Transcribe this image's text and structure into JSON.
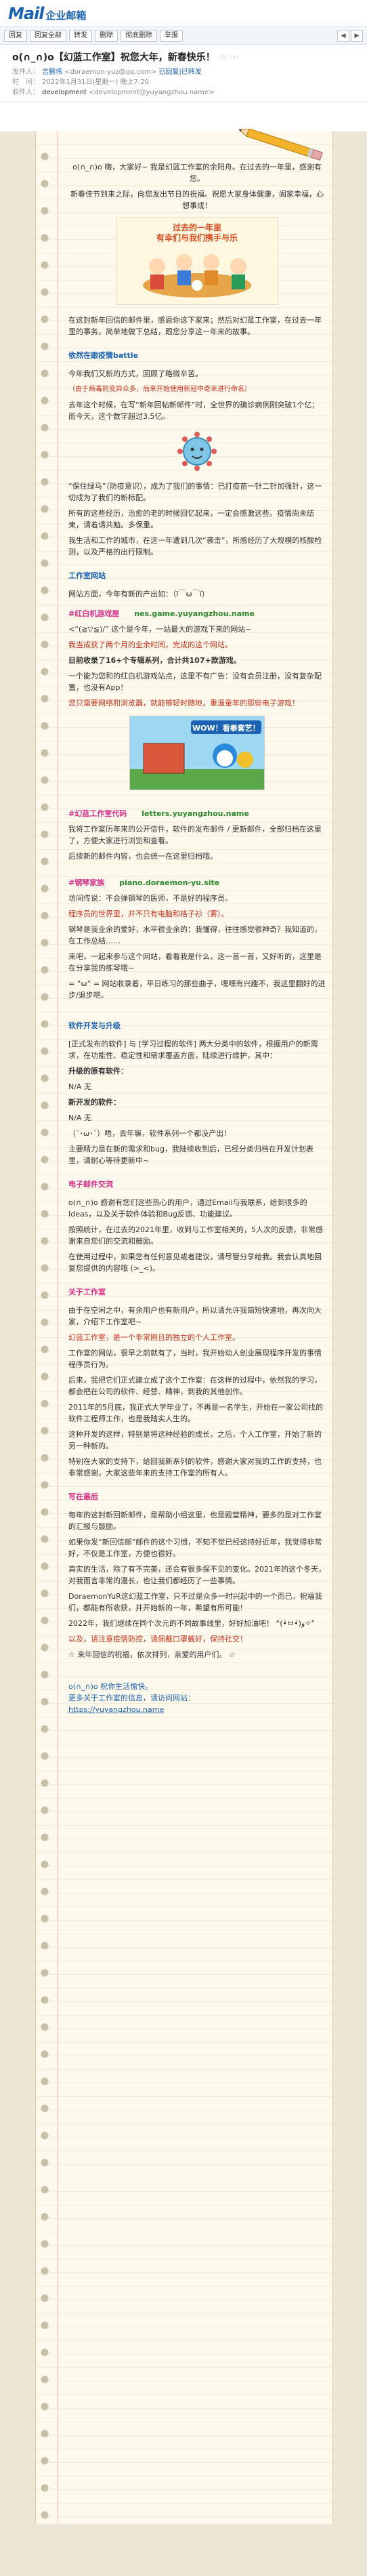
{
  "brand": {
    "logo": "Mail",
    "name": "企业邮箱"
  },
  "toolbar": {
    "buttons": [
      "回复",
      "回复全部",
      "转发",
      "删除",
      "彻底删除",
      "举报"
    ],
    "prev": "◀",
    "next": "▶"
  },
  "email": {
    "subject": "o(∩_∩)o【幻蓝工作室】祝您大年，新春快乐！",
    "from_label": "发件人：",
    "from_name": "吉鹏伟",
    "from_addr": "<doraemon-yuz@qq.com>",
    "from_extra": "已回复|已转发",
    "time_label": "时　间：",
    "time": "2022年1月31日(星期一) 晚上7:20",
    "to_label": "收件人：",
    "to_name": "development",
    "to_addr": "<development@yuyangzhou.name>"
  },
  "body": {
    "p1": "o(∩_∩)o 嗨，大家好~ 我是幻蓝工作室的余阳舟。在过去的一年里，感谢有您。",
    "p2": "新春佳节到来之际，向您发出节日的祝福。祝愿大家身体健康，阖家幸福，心想事成！",
    "illus_cap1": "过去的一年里",
    "illus_cap2": "有幸们与我们携手与乐",
    "p3": "在这封新年回信的邮件里，感恩你这下家来；然后对幻蓝工作室，在过去一年里的事务，简单地做下总结，跟您分享这一年来的故事。",
    "sec1": "依然在跟疫情battle",
    "p4": "今年我们又新的方式，回顾了略微辛苦。",
    "p4b": "（由于病毒的变异众多，后来开始使用新冠中奇米进行命名）",
    "p5": "去年这个时候，在写“新年回帖新邮件”时，全世界的确诊病例刚突破1个亿；而今天，这个数字超过3.5亿。",
    "p6": "“保住绿马”（防疫意识），成为了我们的事情：已打疫苗一针二针加强针，这一切成为了我们的新标配。",
    "p7": "所有的这些经历，治愈的老的时候回忆起来，一定会感激这些。疫情尚未结束，请着请共勉。多保重。",
    "p8": "我生活和工作的城市，在这一年遭到几次“袭击”，所感经历了大规模的核酸检测，以及严格的出行限制。",
    "sec2": "工作室网站",
    "p9": "网站方面，今年有新的产出如：（ï￣ω￣ï）",
    "s3_title": "#红白机游戏屋",
    "s3_domain": "nes.game.yuyangzhou.name",
    "p10": "<“(≧▽≦)/” 这个是今年，一站最大的游戏下来的网站~",
    "p11": "我当成获了两个月的业余时间，完成的这个网站。",
    "p12": "目前收录了16+个专辑系列，合计共107+款游戏。",
    "p13": "一个能为您和的红白机游戏站点，这里不有广告：没有会员注册，没有复杂配置，也没有App！",
    "p14": "您只需要网络和浏览器，就能够轻时随地，重温童年的那些电子游戏！",
    "game_title": "WOW！看拳套艺！",
    "s4_title": "#幻蓝工作室代码",
    "s4_domain": "letters.yuyangzhou.name",
    "p15": "我将工作室历年来的公开信件，软件的发布邮件 / 更新邮件，全部归档在这里了，方便大家进行浏览和查看。",
    "p16": "后续新的邮件内容，也会统一在这里归档哦。",
    "s5_title": "#钢琴家族",
    "s5_domain": "piano.doraemon-yu.site",
    "p17": "坊间传说：不会弹钢琴的医师，不是好的程序员。",
    "p17b": "程序员的世界里，并不只有电脑和格子衫（雾）。",
    "p18": "钢琴是我业余的爱好，水平很业余的：我懂得，往往感觉很神奇？我知道的，在工作总结……",
    "p19": "来吧，一起来参与这个网站，看看我是什么，这一首一首，又好听的，这里是在分享我的练琴哦~",
    "p20": "= “ω” = 网站收录着，平日练习的那些曲子，嘿嘿有兴趣不，我这里翻好的进步/退步吧。",
    "sec3": "软件开发与升级",
    "p21": "[正式发布的软件] 与 [学习过程的软件] 两大分类中的软件，根据用户的新需求，在功能性、稳定性和需求覆盖方面，陆续进行维护，其中：",
    "p22a": "升级的原有软件：",
    "p22b": "N/A 无",
    "p23a": "新开发的软件：",
    "p23b": "N/A 无",
    "p24": "（´･ω･`）唔，去年嘛，软件系列一个都没产出！",
    "p25": "主要精力是在新的需求和bug，我陆续收到后，已经分类归档在开发计划表里，请耐心等待更新中~",
    "sec4": "电子邮件交流",
    "p26": "o(∩_∩)o 感谢有您们这些热心的用户，通过Email与我联系，给到很多的Ideas，以及关于软件体验和Bug反馈、功能建议。",
    "p27": "按照统计，在过去的2021年里，收到与工作室相关的，5人次的反馈，非常感谢来自您们的交流和鼓励。",
    "p28": "在使用过程中，如果您有任何意见或者建议，请尽管分享给我。我会认真地回复您提供的内容哦 (>_<)。",
    "sec5": "关于工作室",
    "p29": "由于在空闲之中，有余用户也有新用户，所以请允许我简短快速地，再次向大家，介绍下工作室吧~",
    "p30": "幻蓝工作室，是一个非常刚且的独立的个人工作室。",
    "p31": "工作室的网站，很早之前就有了，当时，我开始动人创业展现程序开发的事情程序员行为。",
    "p32": "后来，我把它们正式建立成了这个工作室：在这样的过程中，依然我的学习，都会把在公司的软件、经营、精神，到我的其他创作。",
    "p33": "2011年的5月底，我正式大学毕业了，不再是一名学生，开始在一家公司找的软件工程师工作，也是我踏实人生的。",
    "p34": "这种开发的这样，特别是将这种经验的成长，之后，个人工作室，开始了新的另一种新的。",
    "p35": "特别在大家的支持下，给回我新系列的软件，感谢大家对我的工作的支持，也非常感谢，大家这些年来的支持工作室的所有人。",
    "sec6": "写在最后",
    "p36": "每年的这封新回新邮件，是帮助小组这里，也是殿堂精神，要多的是对工作室的汇报与鼓励。",
    "p37": "如果你发“新回信邮”邮件的这个习惯，不知不觉已经这持好近年，我觉得非常好，不仅是工作室，方便也很好。",
    "p38": "真实的生活，除了有不完美，还会有很多探不见的变化。2021年的这个冬天，对我而言非常的漫长，也让我们都经历了一些事情。",
    "p39": "DoraemonYuR这幻蓝工作室，只不过是众多一时兴起中的一个而已，祝福我们，都能有所收获，并开始新的一年，希望有所可能！",
    "p40": "2022年，我们继续在同个次元的不同故事线里，好好加油吧！ “(•̀ㅂ•́)و✧”",
    "p41": "以及，请注意疫情防控，请佩戴口罩戴好，保持社交！",
    "p42": "☆ 来年回信的祝福，依次排列，亲爱的用户们。 ☆",
    "foot1": "o(∩_∩)o 祝你生活愉快。",
    "foot2": "更多关于工作室的信息，请访问网站：",
    "foot3": "https://yuyangzhou.name"
  },
  "colors": {
    "accent": "#1b62b3",
    "red": "#c8321e",
    "paper": "#fdf9ec"
  }
}
